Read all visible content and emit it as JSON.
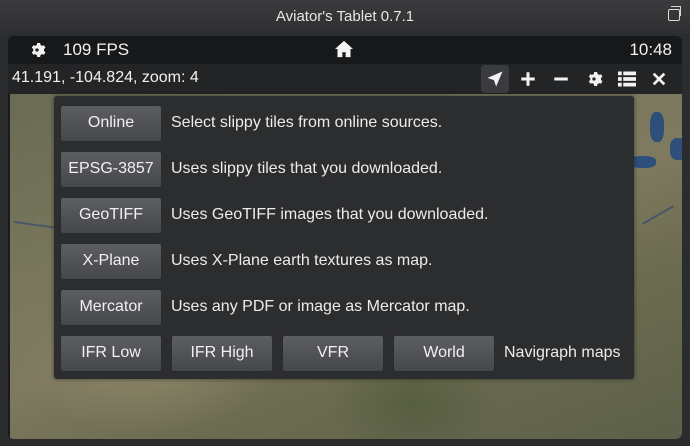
{
  "window": {
    "title": "Aviator's Tablet  0.7.1"
  },
  "statusbar": {
    "fps": "109 FPS",
    "clock": "10:48"
  },
  "toolbar": {
    "coords": "41.191, -104.824, zoom: 4"
  },
  "menu": {
    "rows": [
      {
        "button": "Online",
        "description": "Select slippy tiles from online sources."
      },
      {
        "button": "EPSG-3857",
        "description": "Uses slippy tiles that you downloaded."
      },
      {
        "button": "GeoTIFF",
        "description": "Uses GeoTIFF images that you downloaded."
      },
      {
        "button": "X-Plane",
        "description": "Uses X-Plane earth textures as map."
      },
      {
        "button": "Mercator",
        "description": "Uses any PDF or image as Mercator map."
      }
    ],
    "navigraph": {
      "buttons": [
        "IFR Low",
        "IFR High",
        "VFR",
        "World"
      ],
      "label": "Navigraph maps"
    }
  }
}
